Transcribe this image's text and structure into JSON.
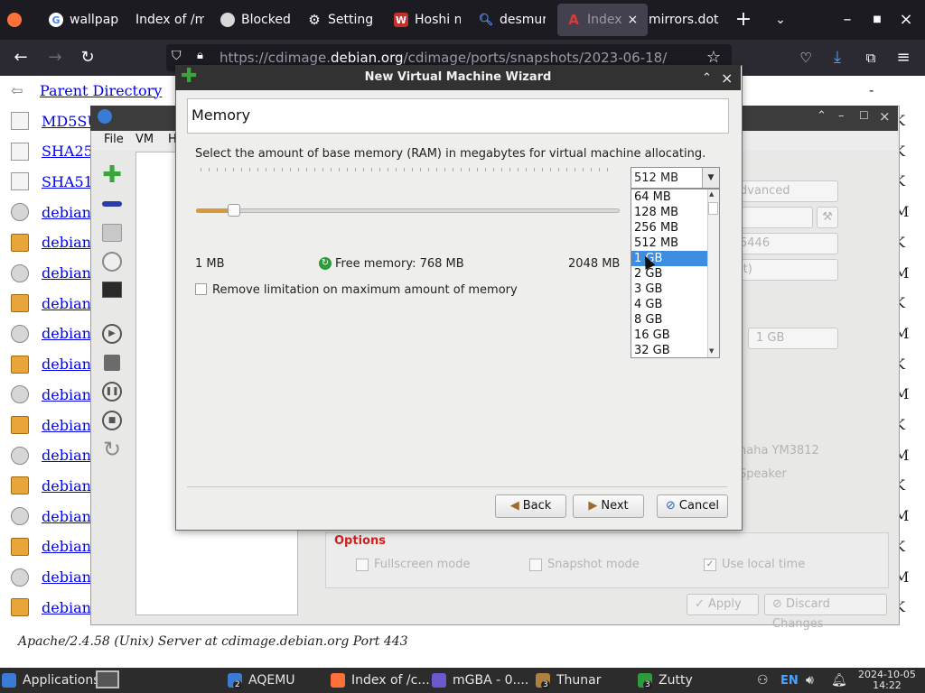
{
  "browser": {
    "tabs": [
      {
        "label": "",
        "icon": "firefox-icon"
      },
      {
        "label": "wallpap",
        "icon": "google-icon"
      },
      {
        "label": "Index of /m",
        "icon": "page-icon"
      },
      {
        "label": "Blocked",
        "icon": "blocked-icon"
      },
      {
        "label": "Setting",
        "icon": "gear-icon"
      },
      {
        "label": "Hoshi n",
        "icon": "w-icon"
      },
      {
        "label": "desmur",
        "icon": "search-icon"
      },
      {
        "label": "Index",
        "icon": "a-icon"
      },
      {
        "label": "mirrors.dot",
        "icon": "page-icon"
      }
    ],
    "url": "https://cdimage.debian.org/cdimage/ports/snapshots/2023-06-18/",
    "url_prefix": "https://cdimage.",
    "url_domain": "debian.org",
    "url_suffix": "/cdimage/ports/snapshots/2023-06-18/"
  },
  "listing": {
    "parent": "Parent Directory",
    "parent_dash": "-",
    "rows": [
      {
        "name": "MD5SU",
        "size": "K"
      },
      {
        "name": "SHA25",
        "size": "K"
      },
      {
        "name": "SHA51",
        "size": "K"
      },
      {
        "name": "debian",
        "size": "M"
      },
      {
        "name": "debian",
        "size": "K"
      },
      {
        "name": "debian",
        "size": "M"
      },
      {
        "name": "debian",
        "size": "K"
      },
      {
        "name": "debian",
        "size": "M"
      },
      {
        "name": "debian",
        "size": "K"
      },
      {
        "name": "debian",
        "size": "M"
      },
      {
        "name": "debian",
        "size": "K"
      },
      {
        "name": "debian",
        "size": "M"
      },
      {
        "name": "debian",
        "size": "K"
      },
      {
        "name": "debian",
        "size": "M"
      },
      {
        "name": "debian",
        "size": "K"
      },
      {
        "name": "debian",
        "size": "M"
      },
      {
        "name": "debian",
        "size": "K"
      }
    ],
    "footer": "Apache/2.4.58 (Unix) Server at cdimage.debian.org Port 443"
  },
  "aqemu": {
    "menu": [
      "File",
      "VM",
      "H"
    ],
    "ghost": {
      "advanced": "dvanced",
      "port": "5446",
      "mode": "lt)",
      "mem": "1 GB",
      "sound1": "haha YM3812",
      "sound2": "Speaker"
    },
    "options_label": "Options",
    "fullscreen": "Fullscreen mode",
    "snapshot": "Snapshot mode",
    "localtime": "Use local time",
    "apply": "Apply",
    "discard": "Discard Changes"
  },
  "wizard": {
    "title": "New Virtual Machine Wizard",
    "heading": "Memory",
    "description": "Select the amount of base memory (RAM) in megabytes for virtual machine allocating.",
    "min_label": "1 MB",
    "max_label": "2048 MB",
    "free_memory": "Free memory: 768 MB",
    "remove_limit": "Remove limitation on maximum amount of memory",
    "selected_value": "512 MB",
    "options": [
      "64 MB",
      "128 MB",
      "256 MB",
      "512 MB",
      "1 GB",
      "2 GB",
      "3 GB",
      "4 GB",
      "8 GB",
      "16 GB",
      "32 GB"
    ],
    "highlighted_option": "1 GB",
    "slider_fraction": 0.09,
    "back": "Back",
    "next": "Next",
    "cancel": "Cancel"
  },
  "taskbar": {
    "applications": "Applications",
    "items": [
      {
        "label": "AQEMU",
        "badge": "2"
      },
      {
        "label": "Index of /c...",
        "badge": ""
      },
      {
        "label": "mGBA - 0....",
        "badge": ""
      },
      {
        "label": "Thunar",
        "badge": "3"
      },
      {
        "label": "Zutty",
        "badge": "3"
      }
    ],
    "lang": "EN",
    "date": "2024-10-05",
    "time": "14:22"
  },
  "colors": {
    "selection": "#3d8ee0",
    "link": "#0000ee",
    "options_red": "#d52020",
    "slider_fill": "#d79a3a"
  }
}
